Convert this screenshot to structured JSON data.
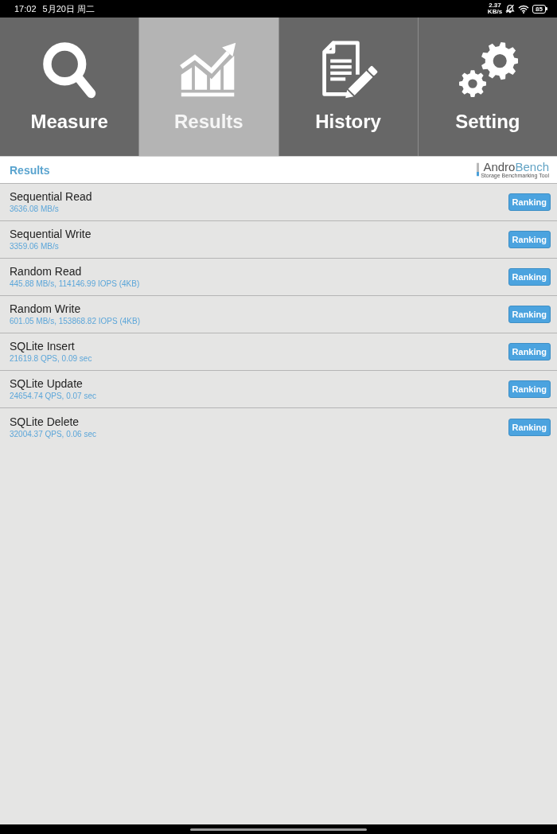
{
  "status_bar": {
    "time": "17:02",
    "date": "5月20日 周二",
    "network_speed": {
      "value": "2.37",
      "unit": "KB/s"
    },
    "battery": "85"
  },
  "tabs": [
    {
      "label": "Measure",
      "selected": false
    },
    {
      "label": "Results",
      "selected": true
    },
    {
      "label": "History",
      "selected": false
    },
    {
      "label": "Setting",
      "selected": false
    }
  ],
  "header": {
    "title": "Results",
    "logo": {
      "name_start": "Andro",
      "name_end": "Bench",
      "tagline": "Storage Benchmarking Tool"
    }
  },
  "results": [
    {
      "name": "Sequential Read",
      "score": "3636.08 MB/s",
      "button": "Ranking"
    },
    {
      "name": "Sequential Write",
      "score": "3359.06 MB/s",
      "button": "Ranking"
    },
    {
      "name": "Random Read",
      "score": "445.88 MB/s, 114146.99 IOPS (4KB)",
      "button": "Ranking"
    },
    {
      "name": "Random Write",
      "score": "601.05 MB/s, 153868.82 IOPS (4KB)",
      "button": "Ranking"
    },
    {
      "name": "SQLite Insert",
      "score": "21619.8 QPS, 0.09 sec",
      "button": "Ranking"
    },
    {
      "name": "SQLite Update",
      "score": "24654.74 QPS, 0.07 sec",
      "button": "Ranking"
    },
    {
      "name": "SQLite Delete",
      "score": "32004.37 QPS, 0.06 sec",
      "button": "Ranking"
    }
  ]
}
